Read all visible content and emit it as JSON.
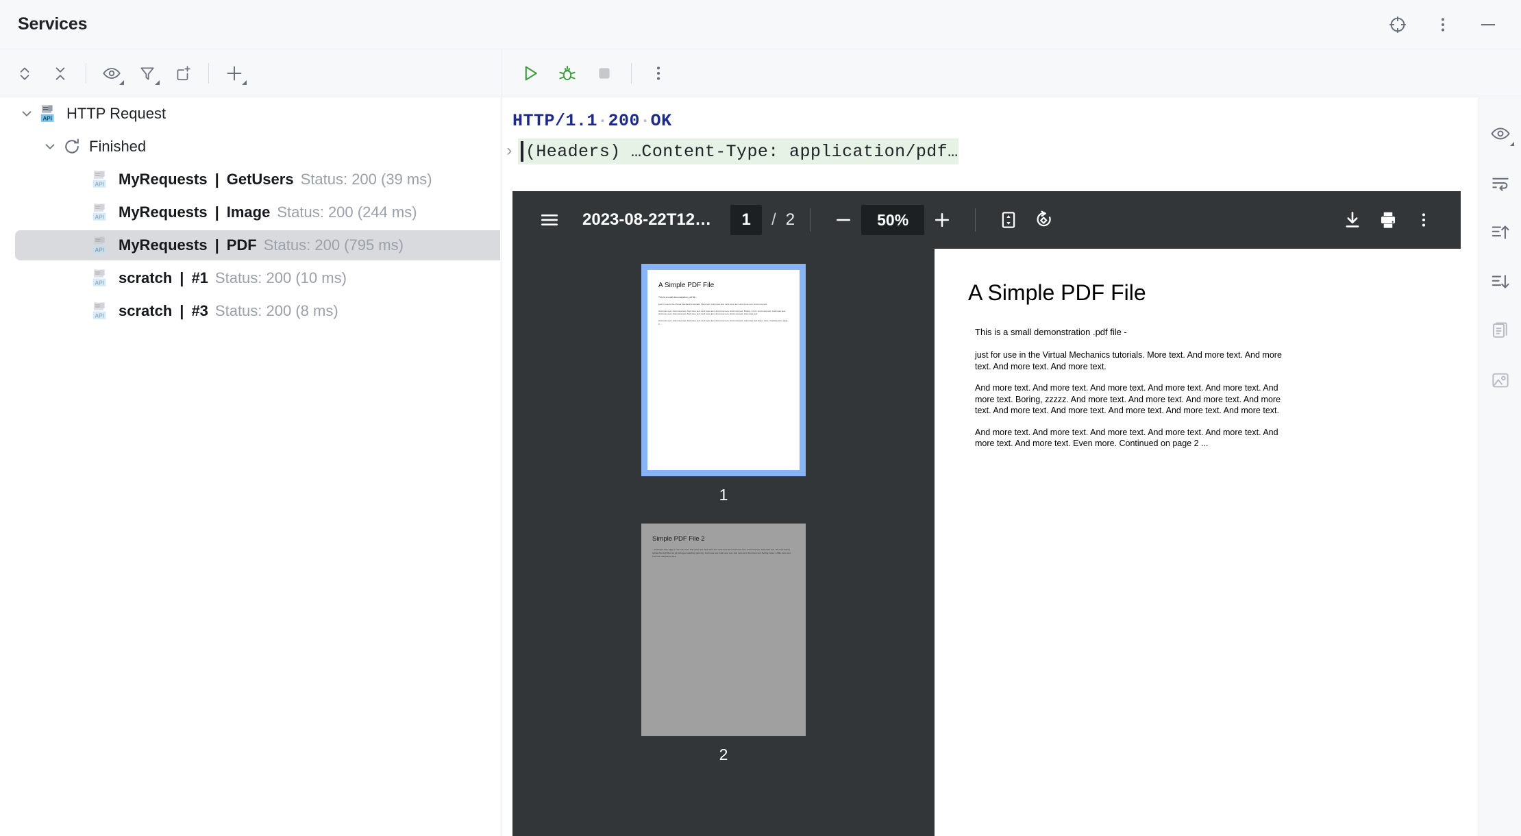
{
  "window": {
    "title": "Services",
    "actions": [
      {
        "name": "locate-icon",
        "label": "Locate"
      },
      {
        "name": "more-options-icon",
        "label": "Options"
      },
      {
        "name": "minimize-icon",
        "label": "Minimize"
      }
    ]
  },
  "left_toolbar": [
    {
      "name": "expand-all-icon",
      "label": "Expand All"
    },
    {
      "name": "collapse-all-icon",
      "label": "Collapse All"
    },
    {
      "name": "show-icon",
      "label": "Show"
    },
    {
      "name": "filter-icon",
      "label": "Filter"
    },
    {
      "name": "open-in-new-tab-icon",
      "label": "Open in New Tab"
    },
    {
      "name": "add-icon",
      "label": "Add"
    }
  ],
  "run_toolbar": [
    {
      "name": "run-icon",
      "label": "Run"
    },
    {
      "name": "debug-icon",
      "label": "Debug"
    },
    {
      "name": "stop-icon",
      "label": "Stop"
    },
    {
      "name": "more-options-icon",
      "label": "More"
    }
  ],
  "tree": {
    "root": {
      "label": "HTTP Request",
      "icon": "api-icon",
      "expanded": true
    },
    "group": {
      "label": "Finished",
      "icon": "reload-icon",
      "expanded": true
    },
    "items": [
      {
        "file": "MyRequests",
        "request": "GetUsers",
        "status": "Status: 200 (39 ms)",
        "selected": false
      },
      {
        "file": "MyRequests",
        "request": "Image",
        "status": "Status: 200 (244 ms)",
        "selected": false
      },
      {
        "file": "MyRequests",
        "request": "PDF",
        "status": "Status: 200 (795 ms)",
        "selected": true
      },
      {
        "file": "scratch",
        "request": "#1",
        "status": "Status: 200 (10 ms)",
        "selected": false
      },
      {
        "file": "scratch",
        "request": "#3",
        "status": "Status: 200 (8 ms)",
        "selected": false
      }
    ]
  },
  "response": {
    "protocol": "HTTP/1.1",
    "code": "200",
    "reason": "OK",
    "headers_text": "(Headers) …Content-Type: application/pdf…",
    "headers_arrow": "›"
  },
  "pdf_viewer": {
    "filename": "2023-08-22T12…",
    "current_page": "1",
    "separator": "/",
    "total_pages": "2",
    "zoom": "50%",
    "buttons": [
      {
        "name": "sidebar-toggle-icon",
        "label": "Toggle Sidebar"
      },
      {
        "name": "zoom-out-icon",
        "label": "Zoom Out"
      },
      {
        "name": "zoom-in-icon",
        "label": "Zoom In"
      },
      {
        "name": "fit-page-icon",
        "label": "Fit to Page"
      },
      {
        "name": "rotate-icon",
        "label": "Rotate Counterclockwise"
      },
      {
        "name": "download-icon",
        "label": "Download"
      },
      {
        "name": "print-icon",
        "label": "Print"
      },
      {
        "name": "more-options-icon",
        "label": "More Actions"
      }
    ],
    "thumbnails": [
      {
        "number": "1",
        "title": "A Simple PDF File",
        "selected": true
      },
      {
        "number": "2",
        "title": "Simple PDF File 2",
        "selected": false
      }
    ],
    "page": {
      "title": "A Simple PDF File",
      "paragraphs": [
        "This is a small demonstration .pdf file -",
        "just for use in the Virtual Mechanics tutorials. More text. And more text. And more text. And more text. And more text.",
        "And more text. And more text. And more text. And more text. And more text. And more text. Boring, zzzzz. And more text. And more text. And more text. And more text. And more text. And more text. And more text. And more text. And more text.",
        "And more text. And more text. And more text. And more text. And more text. And more text. And more text. Even more. Continued on page 2 ..."
      ]
    },
    "page2": {
      "title": "Simple PDF File 2",
      "body": "...continued from page 1. Yet more text. And more text. And more text. And more text. And more text. And more text. And more text. Oh, how boring typing this stuff. But not as boring as watching paint dry. And more text. And more text. And more text. And more text. Boring. More, a little more text. The end, and just as well."
    }
  },
  "edge_toolbar": [
    {
      "name": "preview-eye-icon",
      "label": "Preview"
    },
    {
      "name": "soft-wrap-icon",
      "label": "Soft-Wrap"
    },
    {
      "name": "scroll-to-top-icon",
      "label": "Scroll to Top"
    },
    {
      "name": "scroll-to-end-icon",
      "label": "Scroll to End"
    },
    {
      "name": "copy-icon",
      "label": "Copy"
    },
    {
      "name": "image-icon",
      "label": "Image"
    }
  ],
  "colors": {
    "accent_blue": "#1d2a8c",
    "header_highlight": "#e6f2e6",
    "selection_gray": "#d9dade",
    "pdf_chrome": "#323639",
    "thumb_selected": "#8ab4f8",
    "run_green": "#3f9c3f"
  }
}
